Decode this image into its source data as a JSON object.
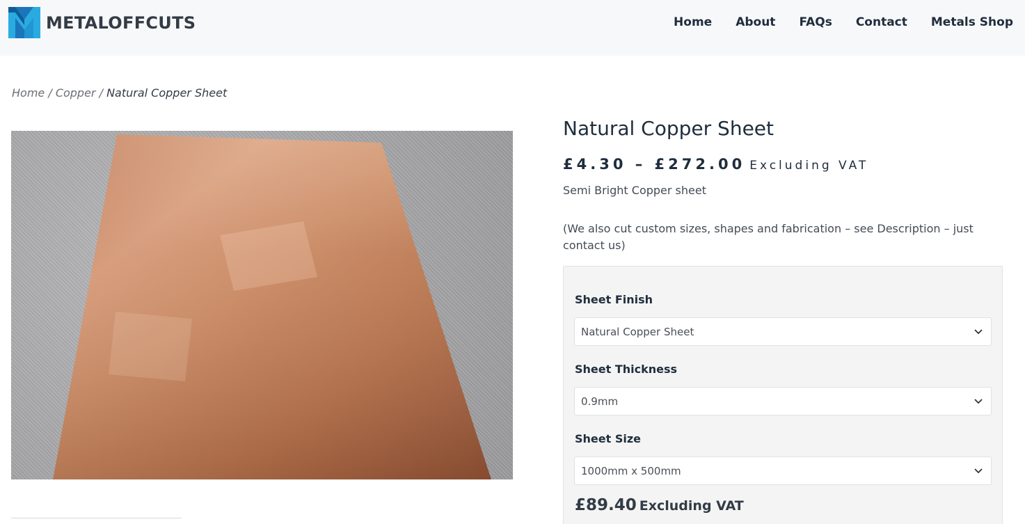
{
  "header": {
    "logo_text": "METALOFFCUTS",
    "logo_icon": "metaloffcuts-m-logo-icon",
    "nav": [
      {
        "label": "Home"
      },
      {
        "label": "About"
      },
      {
        "label": "FAQs"
      },
      {
        "label": "Contact"
      },
      {
        "label": "Metals Shop"
      }
    ]
  },
  "breadcrumb": {
    "items": [
      "Home",
      "Copper"
    ],
    "separator": " / ",
    "current": "Natural Copper Sheet"
  },
  "product": {
    "image_alt": "Natural copper sheet on grey carpet",
    "title": "Natural Copper Sheet",
    "price_range": "£4.30 – £272.00",
    "price_suffix": "Excluding VAT",
    "short_description": "Semi Bright Copper sheet",
    "custom_note": "(We also cut custom sizes, shapes and fabrication – see Description – just contact us)"
  },
  "options": {
    "finish": {
      "label": "Sheet Finish",
      "value": "Natural Copper Sheet"
    },
    "thickness": {
      "label": "Sheet Thickness",
      "value": "0.9mm"
    },
    "size": {
      "label": "Sheet Size",
      "value": "1000mm x 500mm"
    },
    "variation_price": "£89.40",
    "variation_suffix": "Excluding VAT"
  },
  "colors": {
    "brand_blue": "#1b75bb",
    "brand_cyan": "#29abe2",
    "text_dark": "#1f2d3d",
    "copper": "#c07a55"
  }
}
